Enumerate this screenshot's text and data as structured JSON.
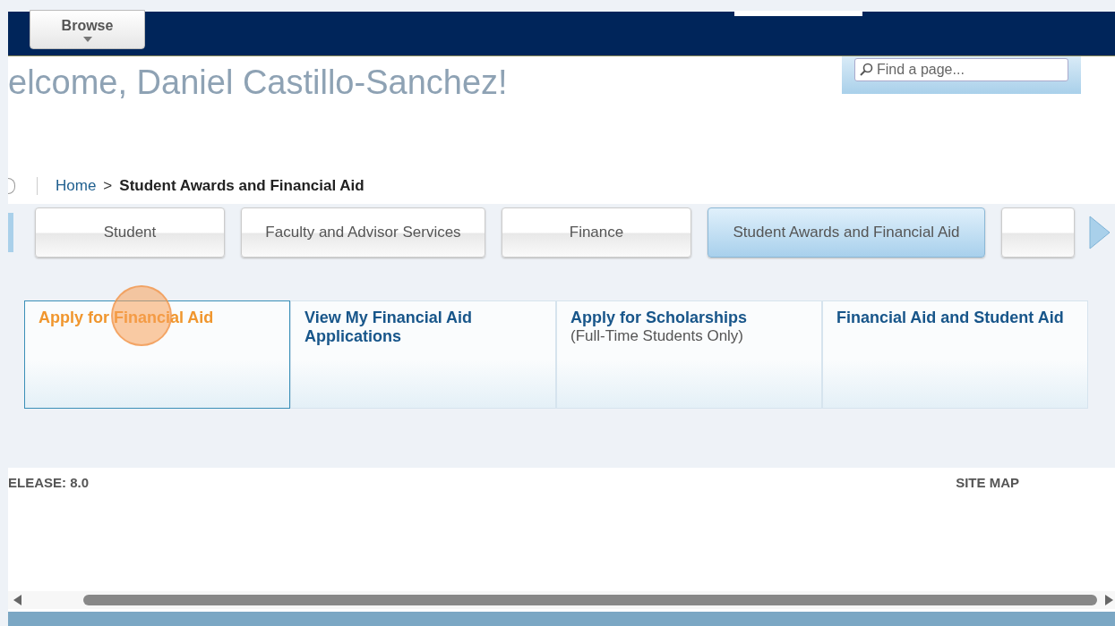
{
  "header": {
    "browse_button": {
      "label": "Browse"
    },
    "search": {
      "placeholder": "Find a page..."
    }
  },
  "welcome": "elcome, Daniel Castillo-Sanchez!",
  "breadcrumb": {
    "home": "Home",
    "separator": ">",
    "current": "Student Awards and Financial Aid"
  },
  "tabs": [
    {
      "label": "Student",
      "selected": false
    },
    {
      "label": "Faculty and Advisor Services",
      "selected": false
    },
    {
      "label": "Finance",
      "selected": false
    },
    {
      "label": "Student Awards and Financial Aid",
      "selected": true
    },
    {
      "selected": false
    }
  ],
  "cards": [
    {
      "title": "Apply for Financial Aid",
      "selected": true
    },
    {
      "title": "View My Financial Aid Applications",
      "selected": false
    },
    {
      "title": "Apply for Scholarships",
      "note": "(Full-Time Students Only)",
      "selected": false
    },
    {
      "title": "Financial Aid and Student Aid",
      "selected": false
    }
  ],
  "footer": {
    "release": "ELEASE: 8.0",
    "site_map": "SITE MAP"
  }
}
